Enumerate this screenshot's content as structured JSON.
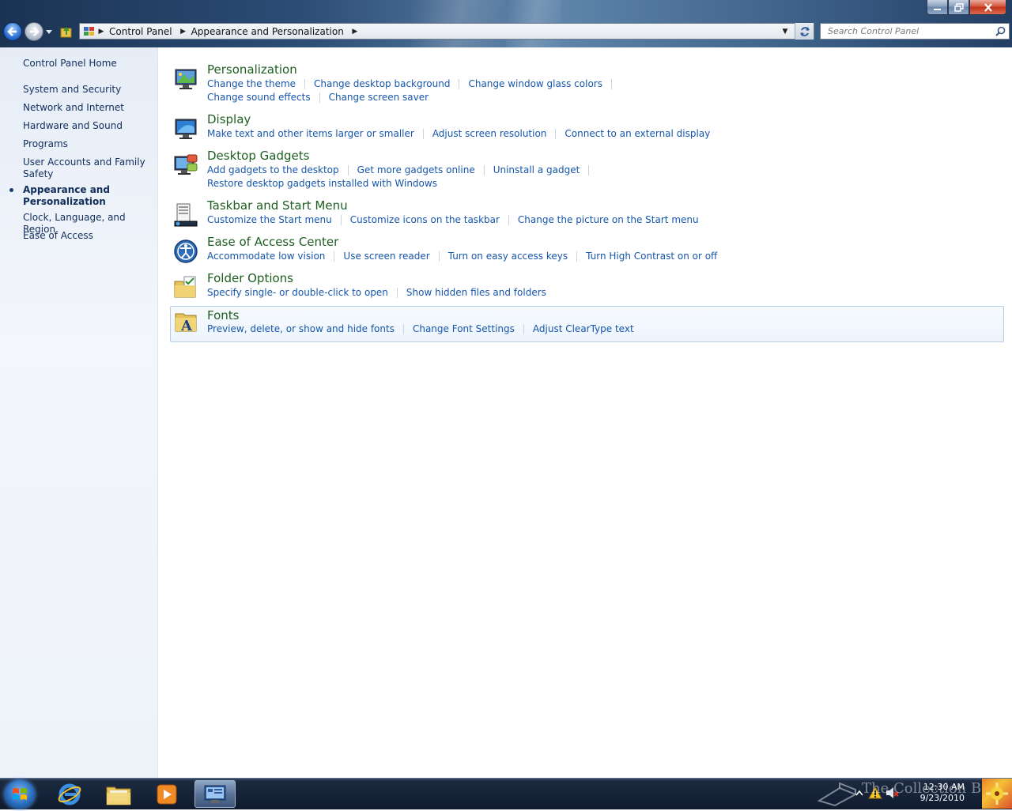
{
  "address": {
    "crumbs": [
      "Control Panel",
      "Appearance and Personalization"
    ],
    "search_placeholder": "Search Control Panel"
  },
  "sidebar": {
    "home": "Control Panel Home",
    "items": [
      {
        "label": "System and Security"
      },
      {
        "label": "Network and Internet"
      },
      {
        "label": "Hardware and Sound"
      },
      {
        "label": "Programs"
      },
      {
        "label": "User Accounts and Family Safety"
      },
      {
        "label": "Appearance and Personalization",
        "current": true
      },
      {
        "label": "Clock, Language, and Region"
      },
      {
        "label": "Ease of Access"
      }
    ]
  },
  "categories": [
    {
      "title": "Personalization",
      "icon": "personalization-icon",
      "lines": [
        [
          "Change the theme",
          "Change desktop background",
          "Change window glass colors"
        ],
        [
          "Change sound effects",
          "Change screen saver"
        ]
      ]
    },
    {
      "title": "Display",
      "icon": "display-icon",
      "lines": [
        [
          "Make text and other items larger or smaller",
          "Adjust screen resolution",
          "Connect to an external display"
        ]
      ]
    },
    {
      "title": "Desktop Gadgets",
      "icon": "gadgets-icon",
      "lines": [
        [
          "Add gadgets to the desktop",
          "Get more gadgets online",
          "Uninstall a gadget"
        ],
        [
          "Restore desktop gadgets installed with Windows"
        ]
      ]
    },
    {
      "title": "Taskbar and Start Menu",
      "icon": "taskbar-icon",
      "lines": [
        [
          "Customize the Start menu",
          "Customize icons on the taskbar",
          "Change the picture on the Start menu"
        ]
      ]
    },
    {
      "title": "Ease of Access Center",
      "icon": "ease-of-access-icon",
      "lines": [
        [
          "Accommodate low vision",
          "Use screen reader",
          "Turn on easy access keys",
          "Turn High Contrast on or off"
        ]
      ]
    },
    {
      "title": "Folder Options",
      "icon": "folder-options-icon",
      "lines": [
        [
          "Specify single- or double-click to open",
          "Show hidden files and folders"
        ]
      ]
    },
    {
      "title": "Fonts",
      "icon": "fonts-icon",
      "lines": [
        [
          "Preview, delete, or show and hide fonts",
          "Change Font Settings",
          "Adjust ClearType text"
        ]
      ]
    }
  ],
  "taskbar": {
    "clock_time": "12:30 AM",
    "clock_date": "9/23/2010",
    "watermark": "The Collection Book"
  },
  "colors": {
    "category_title": "#1e5e21",
    "task_link": "#1656ab",
    "sidebar_link": "#102d5c"
  }
}
